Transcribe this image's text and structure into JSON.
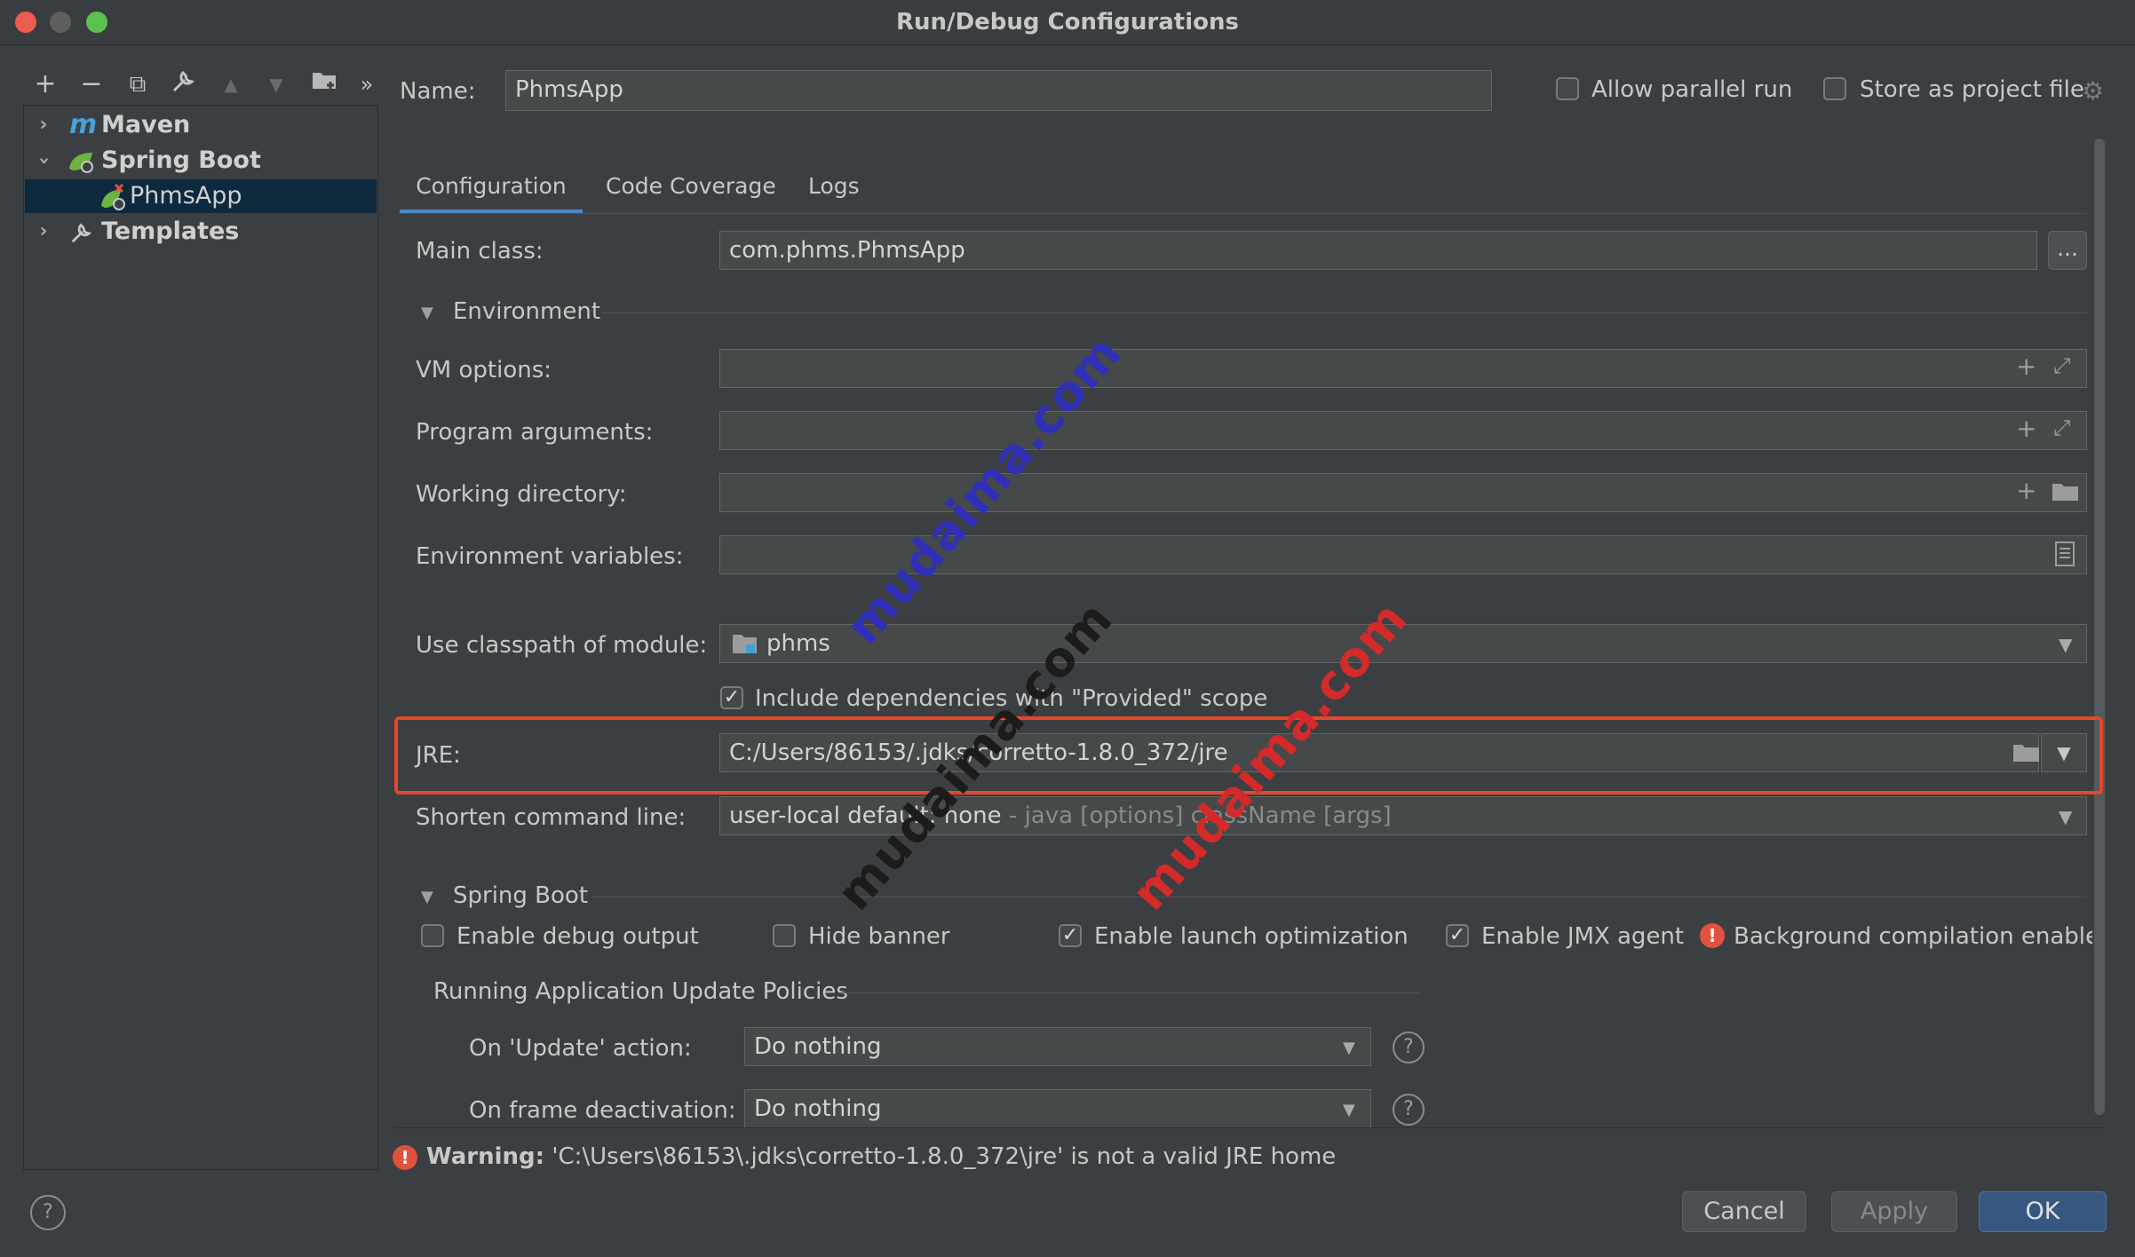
{
  "window": {
    "title": "Run/Debug Configurations"
  },
  "toolbar": {
    "add": "+",
    "remove": "−",
    "copy": "⧉",
    "edit": "🔧",
    "up": "▲",
    "down": "▼",
    "folder": "📁",
    "more": "»"
  },
  "tree": {
    "items": [
      {
        "label": "Maven",
        "icon": "maven-icon"
      },
      {
        "label": "Spring Boot",
        "icon": "spring-boot-icon"
      },
      {
        "label": "PhmsApp",
        "icon": "spring-app-error-icon"
      },
      {
        "label": "Templates",
        "icon": "wrench-icon"
      }
    ]
  },
  "header": {
    "name_label": "Name:",
    "name_value": "PhmsApp",
    "allow_parallel": "Allow parallel run",
    "store_project": "Store as project file"
  },
  "tabs": [
    "Configuration",
    "Code Coverage",
    "Logs"
  ],
  "form": {
    "main_class_label": "Main class:",
    "main_class_value": "com.phms.PhmsApp",
    "browse": "...",
    "environment_section": "Environment",
    "vm_options_label": "VM options:",
    "program_args_label": "Program arguments:",
    "working_dir_label": "Working directory:",
    "env_vars_label": "Environment variables:",
    "classpath_label": "Use classpath of module:",
    "classpath_value": "phms",
    "include_deps": "Include dependencies with \"Provided\" scope",
    "jre_label": "JRE:",
    "jre_value": "C:/Users/86153/.jdks/corretto-1.8.0_372/jre",
    "shorten_label": "Shorten command line:",
    "shorten_value": "user-local default: none",
    "shorten_hint": " - java [options] className [args]",
    "spring_section": "Spring Boot",
    "debug_output": "Enable debug output",
    "hide_banner": "Hide banner",
    "launch_opt": "Enable launch optimization",
    "jmx_agent": "Enable JMX agent",
    "bg_compile": "Background compilation enabled",
    "policies_label": "Running Application Update Policies",
    "update_label": "On 'Update' action:",
    "update_value": "Do nothing",
    "frame_label": "On frame deactivation:",
    "frame_value": "Do nothing"
  },
  "warning": {
    "bold": "Warning:",
    "text": " 'C:\\Users\\86153\\.jdks\\corretto-1.8.0_372\\jre' is not a valid JRE home"
  },
  "buttons": {
    "help": "?",
    "cancel": "Cancel",
    "apply": "Apply",
    "ok": "OK"
  },
  "watermarks": [
    "mudaima.com",
    "mudaima.com",
    "mudaima.com"
  ],
  "colors": {
    "accent": "#365880",
    "error": "#e0523f",
    "highlight": "#e5472d"
  }
}
